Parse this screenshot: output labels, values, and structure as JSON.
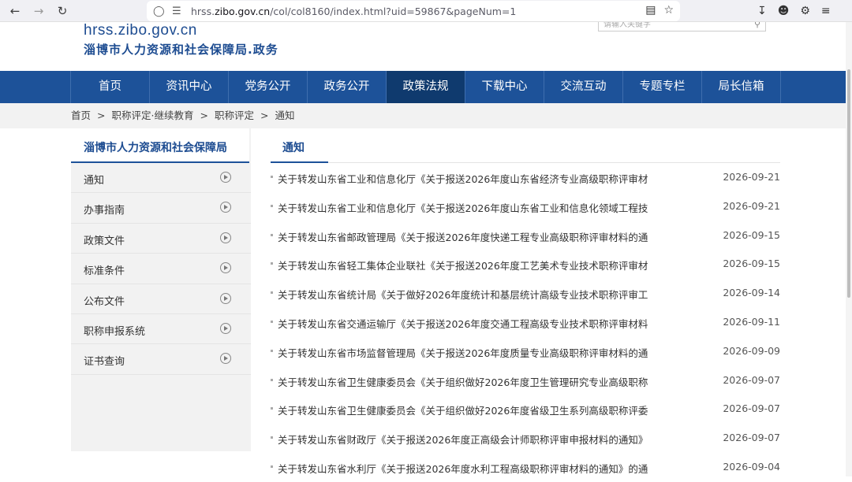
{
  "browser": {
    "url_prefix": "hrss.",
    "url_domain": "zibo.gov.cn",
    "url_path": "/col/col8160/index.html?uid=59867&pageNum=1"
  },
  "header": {
    "domain": "hrss.zibo.gov.cn",
    "org_name": "淄博市人力资源和社会保障局.政务",
    "search_placeholder": "请输入关键字"
  },
  "nav": {
    "items": [
      "首页",
      "资讯中心",
      "党务公开",
      "政务公开",
      "政策法规",
      "下载中心",
      "交流互动",
      "专题专栏",
      "局长信箱"
    ],
    "active_index": 4
  },
  "breadcrumb": [
    "首页",
    "职称评定·继续教育",
    "职称评定",
    "通知"
  ],
  "sidebar": {
    "title": "淄博市人力资源和社会保障局",
    "items": [
      "通知",
      "办事指南",
      "政策文件",
      "标准条件",
      "公布文件",
      "职称申报系统",
      "证书查询"
    ]
  },
  "content": {
    "title": "通知",
    "news": [
      {
        "title": "关于转发山东省工业和信息化厅《关于报送2026年度山东省经济专业高级职称评审材...",
        "date": "2026-09-21"
      },
      {
        "title": "关于转发山东省工业和信息化厅《关于报送2026年度山东省工业和信息化领域工程技...",
        "date": "2026-09-21"
      },
      {
        "title": "关于转发山东省邮政管理局《关于报送2026年度快递工程专业高级职称评审材料的通...",
        "date": "2026-09-15"
      },
      {
        "title": "关于转发山东省轻工集体企业联社《关于报送2026年度工艺美术专业技术职称评审材...",
        "date": "2026-09-15"
      },
      {
        "title": "关于转发山东省统计局《关于做好2026年度统计和基层统计高级专业技术职称评审工...",
        "date": "2026-09-14"
      },
      {
        "title": "关于转发山东省交通运输厅《关于报送2026年度交通工程高级专业技术职称评审材料...",
        "date": "2026-09-11"
      },
      {
        "title": "关于转发山东省市场监督管理局《关于报送2026年度质量专业高级职称评审材料的通...",
        "date": "2026-09-09"
      },
      {
        "title": "关于转发山东省卫生健康委员会《关于组织做好2026年度卫生管理研究专业高级职称...",
        "date": "2026-09-07"
      },
      {
        "title": "关于转发山东省卫生健康委员会《关于组织做好2026年度省级卫生系列高级职称评委...",
        "date": "2026-09-07"
      },
      {
        "title": "关于转发山东省财政厅《关于报送2026年度正高级会计师职称评审申报材料的通知》...",
        "date": "2026-09-07"
      },
      {
        "title": "关于转发山东省水利厅《关于报送2026年度水利工程高级职称评审材料的通知》的通...",
        "date": "2026-09-04"
      }
    ]
  }
}
